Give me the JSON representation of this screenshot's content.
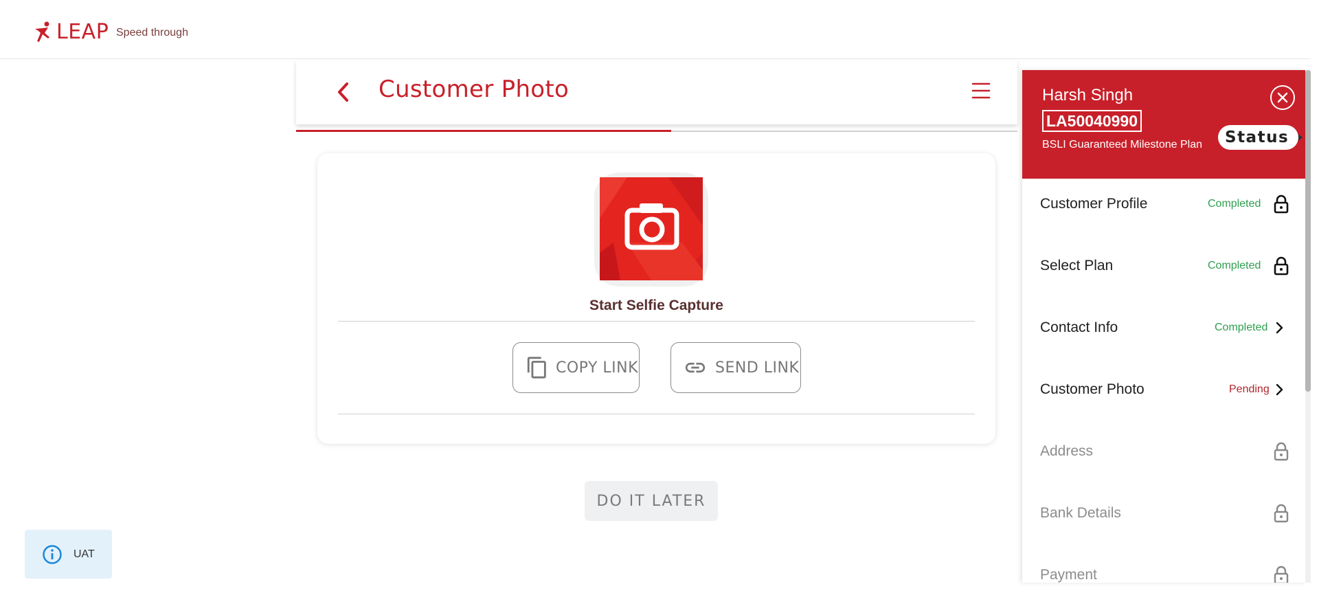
{
  "header": {
    "logo_text": "LEAP",
    "tagline": "Speed through"
  },
  "page": {
    "title": "Customer Photo",
    "progress_fraction": 0.52
  },
  "selfie": {
    "label": "Start Selfie Capture",
    "copy_link_label": "COPY LINK",
    "send_link_label": "SEND LINK"
  },
  "later_label": "DO IT LATER",
  "env_badge": "UAT",
  "side_panel": {
    "customer_name": "Harsh Singh",
    "application_id": "LA50040990",
    "plan_name": "BSLI Guaranteed Milestone Plan",
    "status_label": "Status",
    "steps": [
      {
        "label": "Customer Profile",
        "status": "Completed",
        "icon": "lock-icon"
      },
      {
        "label": "Select Plan",
        "status": "Completed",
        "icon": "lock-icon"
      },
      {
        "label": "Contact Info",
        "status": "Completed",
        "icon": "chevron-right-icon"
      },
      {
        "label": "Customer Photo",
        "status": "Pending",
        "icon": "chevron-right-icon"
      },
      {
        "label": "Address",
        "status": "",
        "icon": "lock-icon"
      },
      {
        "label": "Bank Details",
        "status": "",
        "icon": "lock-icon"
      },
      {
        "label": "Payment",
        "status": "",
        "icon": "lock-icon"
      }
    ]
  },
  "colors": {
    "brand_red": "#c8202a",
    "completed_green": "#2e9e4f",
    "pending_red": "#b1262c",
    "info_blue": "#1a88d6"
  }
}
